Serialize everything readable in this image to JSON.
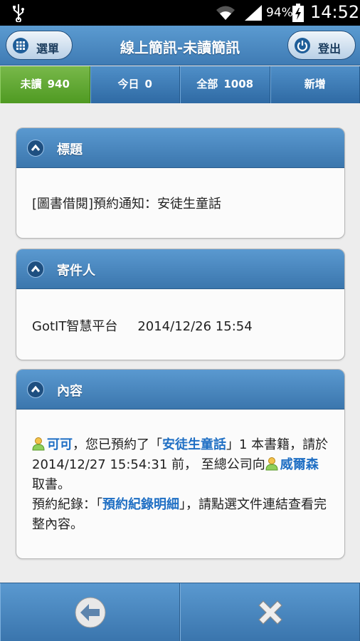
{
  "status_bar": {
    "battery_percent": "94%",
    "time": "14:52",
    "icons": [
      "usb-icon",
      "wifi-icon",
      "signal-icon",
      "battery-charging-icon"
    ]
  },
  "header": {
    "menu_label": "選單",
    "title": "線上簡訊-未讀簡訊",
    "logout_label": "登出"
  },
  "tabs": [
    {
      "label": "未讀",
      "count": "940",
      "active": true
    },
    {
      "label": "今日",
      "count": "0",
      "active": false
    },
    {
      "label": "全部",
      "count": "1008",
      "active": false
    },
    {
      "label": "新增",
      "count": "",
      "active": false
    }
  ],
  "subject_card": {
    "heading": "標題",
    "text": "[圖書借閱]預約通知：安徒生童話"
  },
  "sender_card": {
    "heading": "寄件人",
    "sender": "GotIT智慧平台",
    "date": "2014/12/26 15:54"
  },
  "content_card": {
    "heading": "內容",
    "user_name": "可可",
    "text_1": "，您已預約了「",
    "book_title": "安徒生童話",
    "text_2": "」1 本書籍，請於 2014/12/27 15:54:31 前， 至總公司向",
    "staff_name": "威爾森",
    "text_3": "取書。",
    "text_4": "預約紀錄：「",
    "record_link": "預約紀錄明細",
    "text_5": "」，請點選文件連結查看完整內容。"
  },
  "colors": {
    "header_blue": "#4a8ac4",
    "active_tab_green": "#5fa82e",
    "link_blue": "#1f6fc4"
  }
}
